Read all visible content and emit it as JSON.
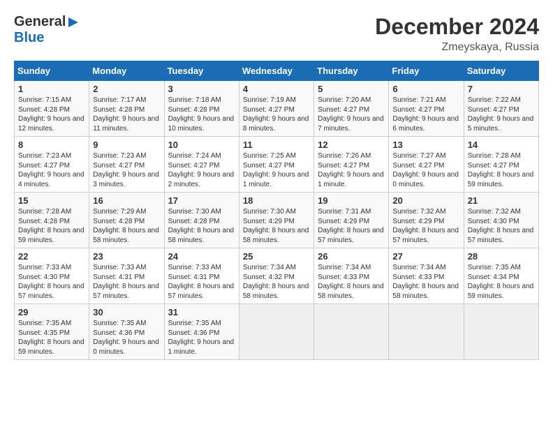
{
  "header": {
    "logo_line1": "General",
    "logo_line2": "Blue",
    "month": "December 2024",
    "location": "Zmeyskaya, Russia"
  },
  "days_of_week": [
    "Sunday",
    "Monday",
    "Tuesday",
    "Wednesday",
    "Thursday",
    "Friday",
    "Saturday"
  ],
  "weeks": [
    [
      {
        "day": "1",
        "info": "Sunrise: 7:15 AM\nSunset: 4:28 PM\nDaylight: 9 hours and 12 minutes."
      },
      {
        "day": "2",
        "info": "Sunrise: 7:17 AM\nSunset: 4:28 PM\nDaylight: 9 hours and 11 minutes."
      },
      {
        "day": "3",
        "info": "Sunrise: 7:18 AM\nSunset: 4:28 PM\nDaylight: 9 hours and 10 minutes."
      },
      {
        "day": "4",
        "info": "Sunrise: 7:19 AM\nSunset: 4:27 PM\nDaylight: 9 hours and 8 minutes."
      },
      {
        "day": "5",
        "info": "Sunrise: 7:20 AM\nSunset: 4:27 PM\nDaylight: 9 hours and 7 minutes."
      },
      {
        "day": "6",
        "info": "Sunrise: 7:21 AM\nSunset: 4:27 PM\nDaylight: 9 hours and 6 minutes."
      },
      {
        "day": "7",
        "info": "Sunrise: 7:22 AM\nSunset: 4:27 PM\nDaylight: 9 hours and 5 minutes."
      }
    ],
    [
      {
        "day": "8",
        "info": "Sunrise: 7:23 AM\nSunset: 4:27 PM\nDaylight: 9 hours and 4 minutes."
      },
      {
        "day": "9",
        "info": "Sunrise: 7:23 AM\nSunset: 4:27 PM\nDaylight: 9 hours and 3 minutes."
      },
      {
        "day": "10",
        "info": "Sunrise: 7:24 AM\nSunset: 4:27 PM\nDaylight: 9 hours and 2 minutes."
      },
      {
        "day": "11",
        "info": "Sunrise: 7:25 AM\nSunset: 4:27 PM\nDaylight: 9 hours and 1 minute."
      },
      {
        "day": "12",
        "info": "Sunrise: 7:26 AM\nSunset: 4:27 PM\nDaylight: 9 hours and 1 minute."
      },
      {
        "day": "13",
        "info": "Sunrise: 7:27 AM\nSunset: 4:27 PM\nDaylight: 9 hours and 0 minutes."
      },
      {
        "day": "14",
        "info": "Sunrise: 7:28 AM\nSunset: 4:27 PM\nDaylight: 8 hours and 59 minutes."
      }
    ],
    [
      {
        "day": "15",
        "info": "Sunrise: 7:28 AM\nSunset: 4:28 PM\nDaylight: 8 hours and 59 minutes."
      },
      {
        "day": "16",
        "info": "Sunrise: 7:29 AM\nSunset: 4:28 PM\nDaylight: 8 hours and 58 minutes."
      },
      {
        "day": "17",
        "info": "Sunrise: 7:30 AM\nSunset: 4:28 PM\nDaylight: 8 hours and 58 minutes."
      },
      {
        "day": "18",
        "info": "Sunrise: 7:30 AM\nSunset: 4:29 PM\nDaylight: 8 hours and 58 minutes."
      },
      {
        "day": "19",
        "info": "Sunrise: 7:31 AM\nSunset: 4:29 PM\nDaylight: 8 hours and 57 minutes."
      },
      {
        "day": "20",
        "info": "Sunrise: 7:32 AM\nSunset: 4:29 PM\nDaylight: 8 hours and 57 minutes."
      },
      {
        "day": "21",
        "info": "Sunrise: 7:32 AM\nSunset: 4:30 PM\nDaylight: 8 hours and 57 minutes."
      }
    ],
    [
      {
        "day": "22",
        "info": "Sunrise: 7:33 AM\nSunset: 4:30 PM\nDaylight: 8 hours and 57 minutes."
      },
      {
        "day": "23",
        "info": "Sunrise: 7:33 AM\nSunset: 4:31 PM\nDaylight: 8 hours and 57 minutes."
      },
      {
        "day": "24",
        "info": "Sunrise: 7:33 AM\nSunset: 4:31 PM\nDaylight: 8 hours and 57 minutes."
      },
      {
        "day": "25",
        "info": "Sunrise: 7:34 AM\nSunset: 4:32 PM\nDaylight: 8 hours and 58 minutes."
      },
      {
        "day": "26",
        "info": "Sunrise: 7:34 AM\nSunset: 4:33 PM\nDaylight: 8 hours and 58 minutes."
      },
      {
        "day": "27",
        "info": "Sunrise: 7:34 AM\nSunset: 4:33 PM\nDaylight: 8 hours and 58 minutes."
      },
      {
        "day": "28",
        "info": "Sunrise: 7:35 AM\nSunset: 4:34 PM\nDaylight: 8 hours and 59 minutes."
      }
    ],
    [
      {
        "day": "29",
        "info": "Sunrise: 7:35 AM\nSunset: 4:35 PM\nDaylight: 8 hours and 59 minutes."
      },
      {
        "day": "30",
        "info": "Sunrise: 7:35 AM\nSunset: 4:36 PM\nDaylight: 9 hours and 0 minutes."
      },
      {
        "day": "31",
        "info": "Sunrise: 7:35 AM\nSunset: 4:36 PM\nDaylight: 9 hours and 1 minute."
      },
      {
        "day": "",
        "info": ""
      },
      {
        "day": "",
        "info": ""
      },
      {
        "day": "",
        "info": ""
      },
      {
        "day": "",
        "info": ""
      }
    ]
  ]
}
